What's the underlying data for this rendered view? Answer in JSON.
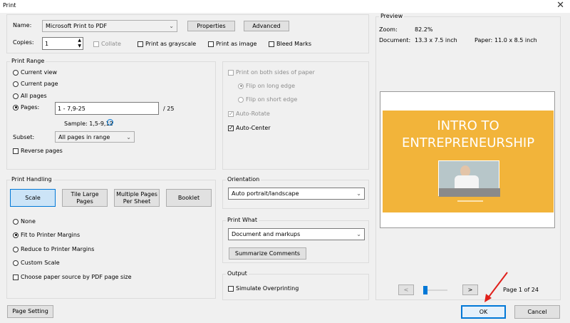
{
  "window": {
    "title": "Print",
    "close_glyph": "✕"
  },
  "printer": {
    "name_label": "Name:",
    "name_value": "Microsoft Print to PDF",
    "properties_button": "Properties",
    "advanced_button": "Advanced",
    "copies_label": "Copies:",
    "copies_value": "1",
    "collate_label": "Collate",
    "grayscale_label": "Print as grayscale",
    "as_image_label": "Print as image",
    "bleed_label": "Bleed Marks"
  },
  "print_range": {
    "title": "Print Range",
    "options": [
      "Current view",
      "Current page",
      "All pages",
      "Pages:"
    ],
    "selected": "Pages:",
    "pages_value": "1 - 7,9-25",
    "pages_total": "/ 25",
    "sample": "Sample: 1,5-9,12",
    "subset_label": "Subset:",
    "subset_value": "All pages in range",
    "reverse_label": "Reverse pages"
  },
  "duplex": {
    "both_sides_label": "Print on both sides of paper",
    "flip_long": "Flip on long edge",
    "flip_short": "Flip on short edge",
    "auto_rotate": "Auto-Rotate",
    "auto_center": "Auto-Center"
  },
  "handling": {
    "title": "Print Handling",
    "tabs": [
      "Scale",
      "Tile Large\nPages",
      "Multiple Pages\nPer Sheet",
      "Booklet"
    ],
    "options": [
      "None",
      "Fit to Printer Margins",
      "Reduce to Printer Margins",
      "Custom Scale"
    ],
    "selected": "Fit to Printer Margins",
    "paper_source_label": "Choose paper source by PDF page size"
  },
  "orientation": {
    "title": "Orientation",
    "value": "Auto portrait/landscape"
  },
  "print_what": {
    "title": "Print What",
    "value": "Document and markups",
    "summarize_button": "Summarize Comments"
  },
  "output": {
    "title": "Output",
    "simulate_label": "Simulate Overprinting"
  },
  "preview": {
    "title": "Preview",
    "zoom_label": "Zoom:",
    "zoom_value": "82.2%",
    "document_label": "Document:",
    "document_value": "13.3 x 7.5 inch",
    "paper_label": "Paper:",
    "paper_value": "11.0 x 8.5 inch",
    "slide_title_line1": "INTRO TO",
    "slide_title_line2": "ENTREPRENEURSHIP",
    "prev_glyph": "<",
    "next_glyph": ">",
    "page_indicator": "Page 1 of 24",
    "slider_fraction": 0.0
  },
  "footer": {
    "page_setting_button": "Page Setting",
    "ok_button": "OK",
    "cancel_button": "Cancel"
  },
  "colors": {
    "accent": "#0078d7",
    "slide_bg": "#f2b43a",
    "arrow": "#e0201b"
  }
}
